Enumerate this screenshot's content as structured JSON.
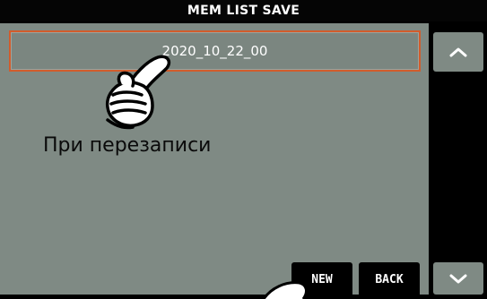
{
  "window": {
    "title": "MEM LIST SAVE"
  },
  "list": {
    "items": [
      {
        "label": "2020_10_22_00",
        "selected": true
      }
    ]
  },
  "annotation": {
    "text": "При перезаписи"
  },
  "buttons": {
    "new_label": "NEW",
    "back_label": "BACK"
  },
  "icons": {
    "scroll_up": "chevron-up-icon",
    "scroll_down": "chevron-down-icon",
    "pointer": "pointing-hand-icon"
  },
  "colors": {
    "panel": "#7f8a84",
    "selection_border": "#d25c2c",
    "button_bg": "#000000",
    "text": "#ffffff"
  }
}
